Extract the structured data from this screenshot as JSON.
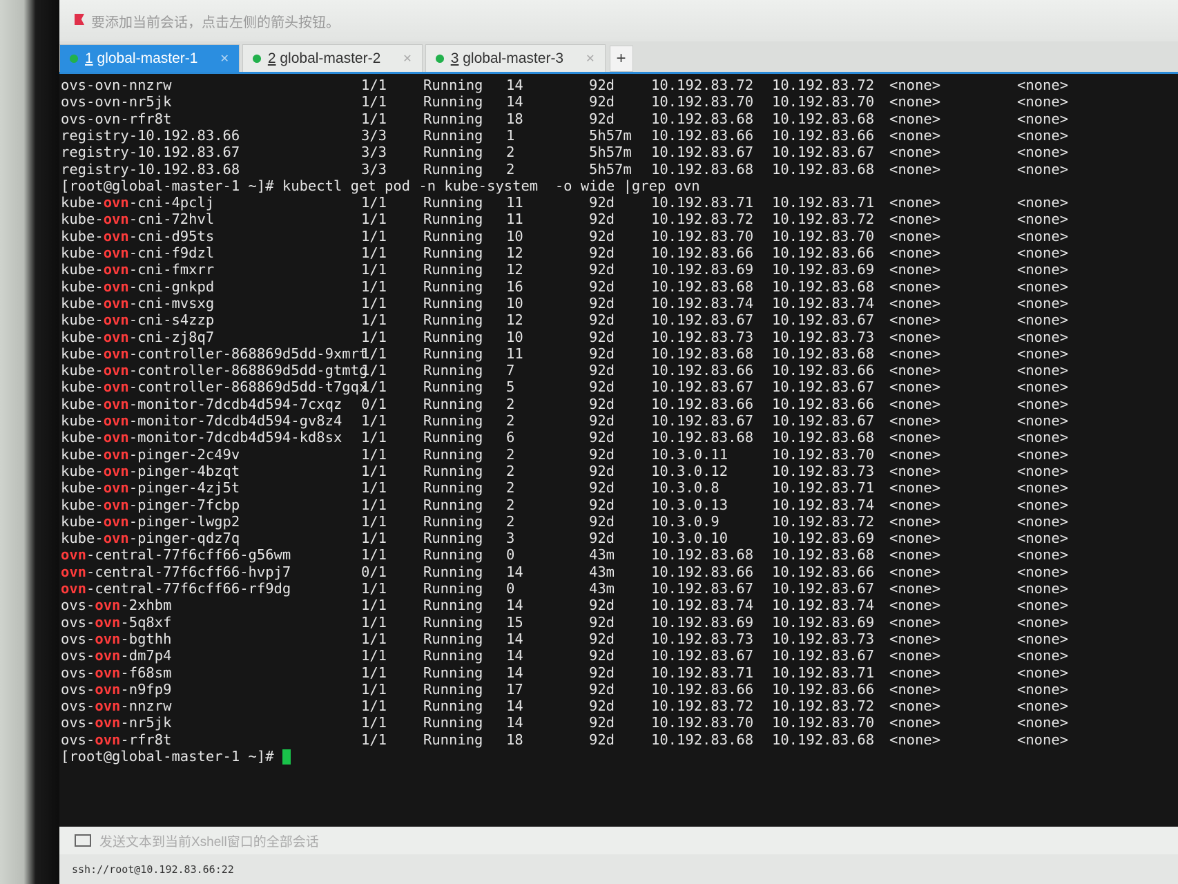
{
  "hint_bar": {
    "text": "要添加当前会话，点击左侧的箭头按钮。"
  },
  "tabs": [
    {
      "num": "1",
      "label": "global-master-1",
      "active": true
    },
    {
      "num": "2",
      "label": "global-master-2",
      "active": false
    },
    {
      "num": "3",
      "label": "global-master-3",
      "active": false
    }
  ],
  "new_tab": "+",
  "top_rows": [
    [
      "ovs-ovn-nnzrw",
      "1/1",
      "Running",
      "14",
      "92d",
      "10.192.83.72",
      "10.192.83.72",
      "<none>",
      "<none>"
    ],
    [
      "ovs-ovn-nr5jk",
      "1/1",
      "Running",
      "14",
      "92d",
      "10.192.83.70",
      "10.192.83.70",
      "<none>",
      "<none>"
    ],
    [
      "ovs-ovn-rfr8t",
      "1/1",
      "Running",
      "18",
      "92d",
      "10.192.83.68",
      "10.192.83.68",
      "<none>",
      "<none>"
    ],
    [
      "registry-10.192.83.66",
      "3/3",
      "Running",
      "1",
      "5h57m",
      "10.192.83.66",
      "10.192.83.66",
      "<none>",
      "<none>"
    ],
    [
      "registry-10.192.83.67",
      "3/3",
      "Running",
      "2",
      "5h57m",
      "10.192.83.67",
      "10.192.83.67",
      "<none>",
      "<none>"
    ],
    [
      "registry-10.192.83.68",
      "3/3",
      "Running",
      "2",
      "5h57m",
      "10.192.83.68",
      "10.192.83.68",
      "<none>",
      "<none>"
    ]
  ],
  "command": "[root@global-master-1 ~]# kubectl get pod -n kube-system  -o wide |grep ovn",
  "ovn_rows": [
    [
      "kube-",
      "ovn",
      "-cni-4pclj",
      "1/1",
      "Running",
      "11",
      "92d",
      "10.192.83.71",
      "10.192.83.71",
      "<none>",
      "<none>"
    ],
    [
      "kube-",
      "ovn",
      "-cni-72hvl",
      "1/1",
      "Running",
      "11",
      "92d",
      "10.192.83.72",
      "10.192.83.72",
      "<none>",
      "<none>"
    ],
    [
      "kube-",
      "ovn",
      "-cni-d95ts",
      "1/1",
      "Running",
      "10",
      "92d",
      "10.192.83.70",
      "10.192.83.70",
      "<none>",
      "<none>"
    ],
    [
      "kube-",
      "ovn",
      "-cni-f9dzl",
      "1/1",
      "Running",
      "12",
      "92d",
      "10.192.83.66",
      "10.192.83.66",
      "<none>",
      "<none>"
    ],
    [
      "kube-",
      "ovn",
      "-cni-fmxrr",
      "1/1",
      "Running",
      "12",
      "92d",
      "10.192.83.69",
      "10.192.83.69",
      "<none>",
      "<none>"
    ],
    [
      "kube-",
      "ovn",
      "-cni-gnkpd",
      "1/1",
      "Running",
      "16",
      "92d",
      "10.192.83.68",
      "10.192.83.68",
      "<none>",
      "<none>"
    ],
    [
      "kube-",
      "ovn",
      "-cni-mvsxg",
      "1/1",
      "Running",
      "10",
      "92d",
      "10.192.83.74",
      "10.192.83.74",
      "<none>",
      "<none>"
    ],
    [
      "kube-",
      "ovn",
      "-cni-s4zzp",
      "1/1",
      "Running",
      "12",
      "92d",
      "10.192.83.67",
      "10.192.83.67",
      "<none>",
      "<none>"
    ],
    [
      "kube-",
      "ovn",
      "-cni-zj8q7",
      "1/1",
      "Running",
      "10",
      "92d",
      "10.192.83.73",
      "10.192.83.73",
      "<none>",
      "<none>"
    ],
    [
      "kube-",
      "ovn",
      "-controller-868869d5dd-9xmrt",
      "1/1",
      "Running",
      "11",
      "92d",
      "10.192.83.68",
      "10.192.83.68",
      "<none>",
      "<none>"
    ],
    [
      "kube-",
      "ovn",
      "-controller-868869d5dd-gtmtg",
      "1/1",
      "Running",
      "7",
      "92d",
      "10.192.83.66",
      "10.192.83.66",
      "<none>",
      "<none>"
    ],
    [
      "kube-",
      "ovn",
      "-controller-868869d5dd-t7gqx",
      "1/1",
      "Running",
      "5",
      "92d",
      "10.192.83.67",
      "10.192.83.67",
      "<none>",
      "<none>"
    ],
    [
      "kube-",
      "ovn",
      "-monitor-7dcdb4d594-7cxqz",
      "0/1",
      "Running",
      "2",
      "92d",
      "10.192.83.66",
      "10.192.83.66",
      "<none>",
      "<none>"
    ],
    [
      "kube-",
      "ovn",
      "-monitor-7dcdb4d594-gv8z4",
      "1/1",
      "Running",
      "2",
      "92d",
      "10.192.83.67",
      "10.192.83.67",
      "<none>",
      "<none>"
    ],
    [
      "kube-",
      "ovn",
      "-monitor-7dcdb4d594-kd8sx",
      "1/1",
      "Running",
      "6",
      "92d",
      "10.192.83.68",
      "10.192.83.68",
      "<none>",
      "<none>"
    ],
    [
      "kube-",
      "ovn",
      "-pinger-2c49v",
      "1/1",
      "Running",
      "2",
      "92d",
      "10.3.0.11",
      "10.192.83.70",
      "<none>",
      "<none>"
    ],
    [
      "kube-",
      "ovn",
      "-pinger-4bzqt",
      "1/1",
      "Running",
      "2",
      "92d",
      "10.3.0.12",
      "10.192.83.73",
      "<none>",
      "<none>"
    ],
    [
      "kube-",
      "ovn",
      "-pinger-4zj5t",
      "1/1",
      "Running",
      "2",
      "92d",
      "10.3.0.8",
      "10.192.83.71",
      "<none>",
      "<none>"
    ],
    [
      "kube-",
      "ovn",
      "-pinger-7fcbp",
      "1/1",
      "Running",
      "2",
      "92d",
      "10.3.0.13",
      "10.192.83.74",
      "<none>",
      "<none>"
    ],
    [
      "kube-",
      "ovn",
      "-pinger-lwgp2",
      "1/1",
      "Running",
      "2",
      "92d",
      "10.3.0.9",
      "10.192.83.72",
      "<none>",
      "<none>"
    ],
    [
      "kube-",
      "ovn",
      "-pinger-qdz7q",
      "1/1",
      "Running",
      "3",
      "92d",
      "10.3.0.10",
      "10.192.83.69",
      "<none>",
      "<none>"
    ],
    [
      "",
      "ovn",
      "-central-77f6cff66-g56wm",
      "1/1",
      "Running",
      "0",
      "43m",
      "10.192.83.68",
      "10.192.83.68",
      "<none>",
      "<none>"
    ],
    [
      "",
      "ovn",
      "-central-77f6cff66-hvpj7",
      "0/1",
      "Running",
      "14",
      "43m",
      "10.192.83.66",
      "10.192.83.66",
      "<none>",
      "<none>"
    ],
    [
      "",
      "ovn",
      "-central-77f6cff66-rf9dg",
      "1/1",
      "Running",
      "0",
      "43m",
      "10.192.83.67",
      "10.192.83.67",
      "<none>",
      "<none>"
    ],
    [
      "ovs-",
      "ovn",
      "-2xhbm",
      "1/1",
      "Running",
      "14",
      "92d",
      "10.192.83.74",
      "10.192.83.74",
      "<none>",
      "<none>"
    ],
    [
      "ovs-",
      "ovn",
      "-5q8xf",
      "1/1",
      "Running",
      "15",
      "92d",
      "10.192.83.69",
      "10.192.83.69",
      "<none>",
      "<none>"
    ],
    [
      "ovs-",
      "ovn",
      "-bgthh",
      "1/1",
      "Running",
      "14",
      "92d",
      "10.192.83.73",
      "10.192.83.73",
      "<none>",
      "<none>"
    ],
    [
      "ovs-",
      "ovn",
      "-dm7p4",
      "1/1",
      "Running",
      "14",
      "92d",
      "10.192.83.67",
      "10.192.83.67",
      "<none>",
      "<none>"
    ],
    [
      "ovs-",
      "ovn",
      "-f68sm",
      "1/1",
      "Running",
      "14",
      "92d",
      "10.192.83.71",
      "10.192.83.71",
      "<none>",
      "<none>"
    ],
    [
      "ovs-",
      "ovn",
      "-n9fp9",
      "1/1",
      "Running",
      "17",
      "92d",
      "10.192.83.66",
      "10.192.83.66",
      "<none>",
      "<none>"
    ],
    [
      "ovs-",
      "ovn",
      "-nnzrw",
      "1/1",
      "Running",
      "14",
      "92d",
      "10.192.83.72",
      "10.192.83.72",
      "<none>",
      "<none>"
    ],
    [
      "ovs-",
      "ovn",
      "-nr5jk",
      "1/1",
      "Running",
      "14",
      "92d",
      "10.192.83.70",
      "10.192.83.70",
      "<none>",
      "<none>"
    ],
    [
      "ovs-",
      "ovn",
      "-rfr8t",
      "1/1",
      "Running",
      "18",
      "92d",
      "10.192.83.68",
      "10.192.83.68",
      "<none>",
      "<none>"
    ]
  ],
  "prompt": "[root@global-master-1 ~]# ",
  "send_bar": {
    "text": "发送文本到当前Xshell窗口的全部会话"
  },
  "status_bar": {
    "text": "ssh://root@10.192.83.66:22"
  },
  "colors": {
    "active_tab": "#2b8ee0",
    "ovn_highlight": "#ff3b3b",
    "cursor": "#19c24a",
    "status_dot": "#22b14c"
  }
}
